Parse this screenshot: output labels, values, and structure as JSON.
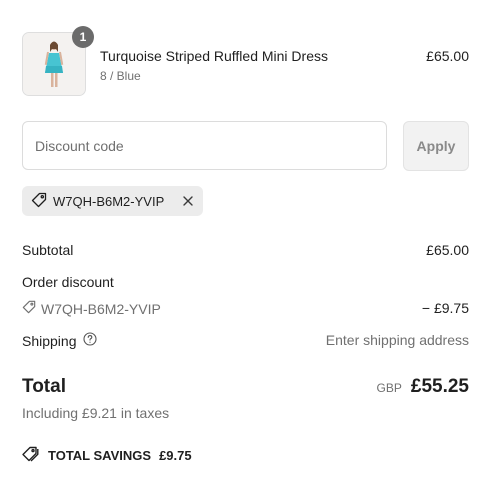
{
  "cart": {
    "items": [
      {
        "name": "Turquoise Striped Ruffled Mini Dress",
        "variant": "8 / Blue",
        "price": "£65.00",
        "quantity": "1"
      }
    ]
  },
  "discount": {
    "placeholder": "Discount code",
    "apply_label": "Apply",
    "applied_code": "W7QH-B6M2-YVIP"
  },
  "summary": {
    "subtotal_label": "Subtotal",
    "subtotal_value": "£65.00",
    "order_discount_label": "Order discount",
    "discount_code": "W7QH-B6M2-YVIP",
    "discount_value": "− £9.75",
    "shipping_label": "Shipping",
    "shipping_value": "Enter shipping address",
    "total_label": "Total",
    "currency": "GBP",
    "total_value": "£55.25",
    "tax_note": "Including £9.21 in taxes",
    "savings_label": "TOTAL SAVINGS",
    "savings_value": "£9.75"
  },
  "icons": {
    "tag": "tag-icon",
    "remove": "close-icon",
    "help": "question-circle-icon",
    "savings": "tags-icon"
  },
  "colors": {
    "badge": "#6b6b6b",
    "chip_background": "#ececec",
    "apply_background": "#f2f2f2"
  }
}
